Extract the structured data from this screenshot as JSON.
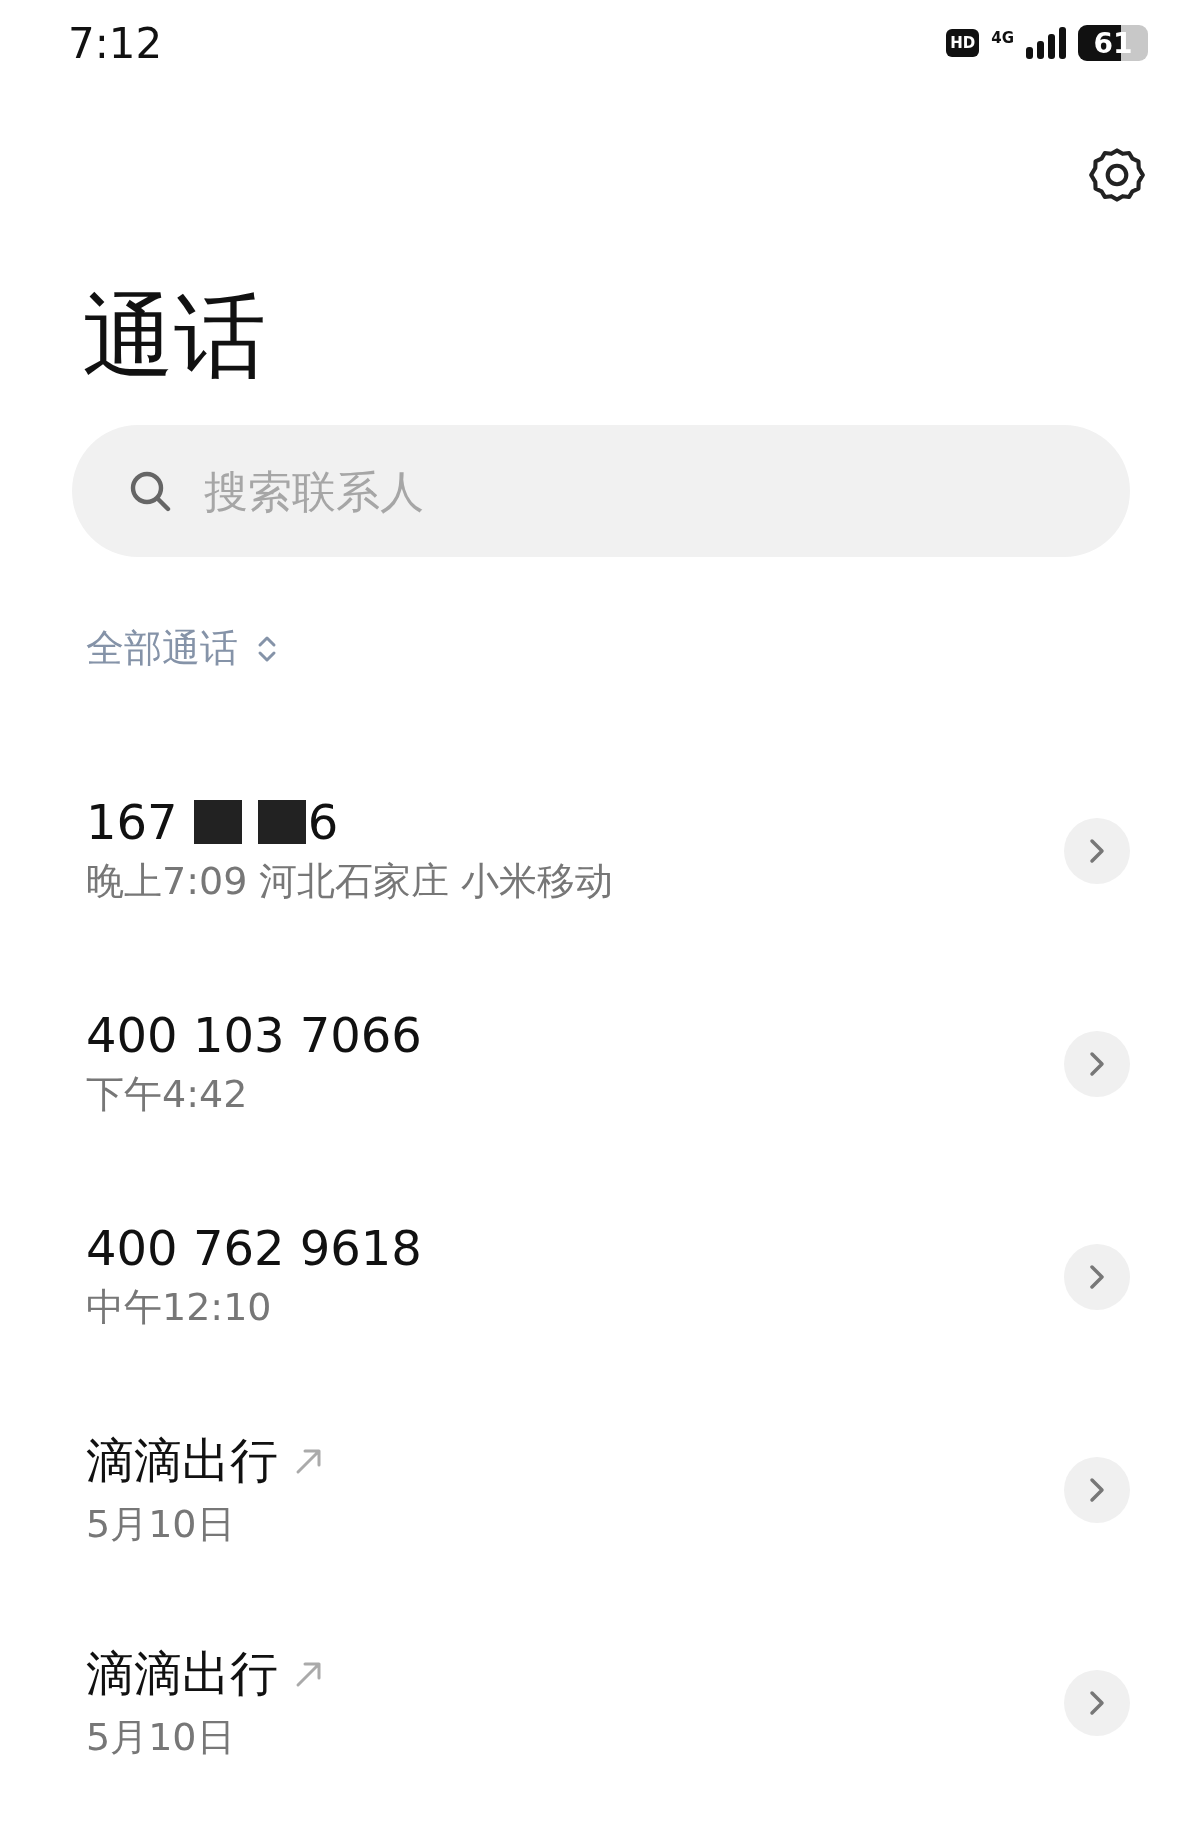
{
  "status_bar": {
    "time": "7:12",
    "hd": "HD",
    "network": "4G",
    "battery": "61"
  },
  "title": "通话",
  "search": {
    "placeholder": "搜索联系人"
  },
  "filter": {
    "label": "全部通话"
  },
  "calls": [
    {
      "name": "167",
      "redacted": true,
      "name_end": "6",
      "detail": "晚上7:09 河北石家庄 小米移动",
      "outgoing": false
    },
    {
      "name": "400 103 7066",
      "redacted": false,
      "detail": "下午4:42",
      "outgoing": false
    },
    {
      "name": "400 762 9618",
      "redacted": false,
      "detail": "中午12:10",
      "outgoing": false
    },
    {
      "name": "滴滴出行",
      "redacted": false,
      "detail": "5月10日",
      "outgoing": true
    },
    {
      "name": "滴滴出行",
      "redacted": false,
      "detail": "5月10日",
      "outgoing": true
    }
  ]
}
